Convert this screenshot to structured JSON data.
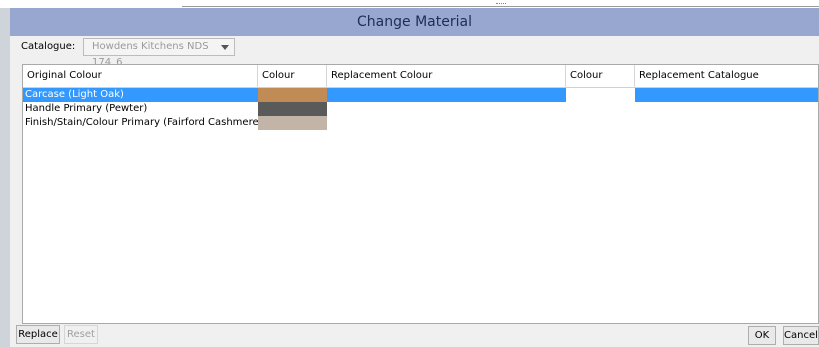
{
  "window": {
    "title": "Change Material"
  },
  "catalogue": {
    "label": "Catalogue:",
    "value": "Howdens Kitchens NDS 174_6"
  },
  "table": {
    "headers": [
      "Original Colour",
      "Colour",
      "Replacement Colour",
      "Colour",
      "Replacement Catalogue"
    ],
    "rows": [
      {
        "original": "Carcase (Light Oak)",
        "swatch": "#c08b55",
        "selected": true
      },
      {
        "original": "Handle Primary (Pewter)",
        "swatch": "#5a5a5a",
        "selected": false
      },
      {
        "original": "Finish/Stain/Colour Primary (Fairford Cashmere)",
        "swatch": "#c2b4a6",
        "selected": false
      }
    ]
  },
  "buttons": {
    "replace": "Replace",
    "reset": "Reset",
    "ok": "OK",
    "cancel": "Cancel"
  },
  "colors": {
    "titlebar": "#98a7cf",
    "selection": "#3399ff"
  }
}
